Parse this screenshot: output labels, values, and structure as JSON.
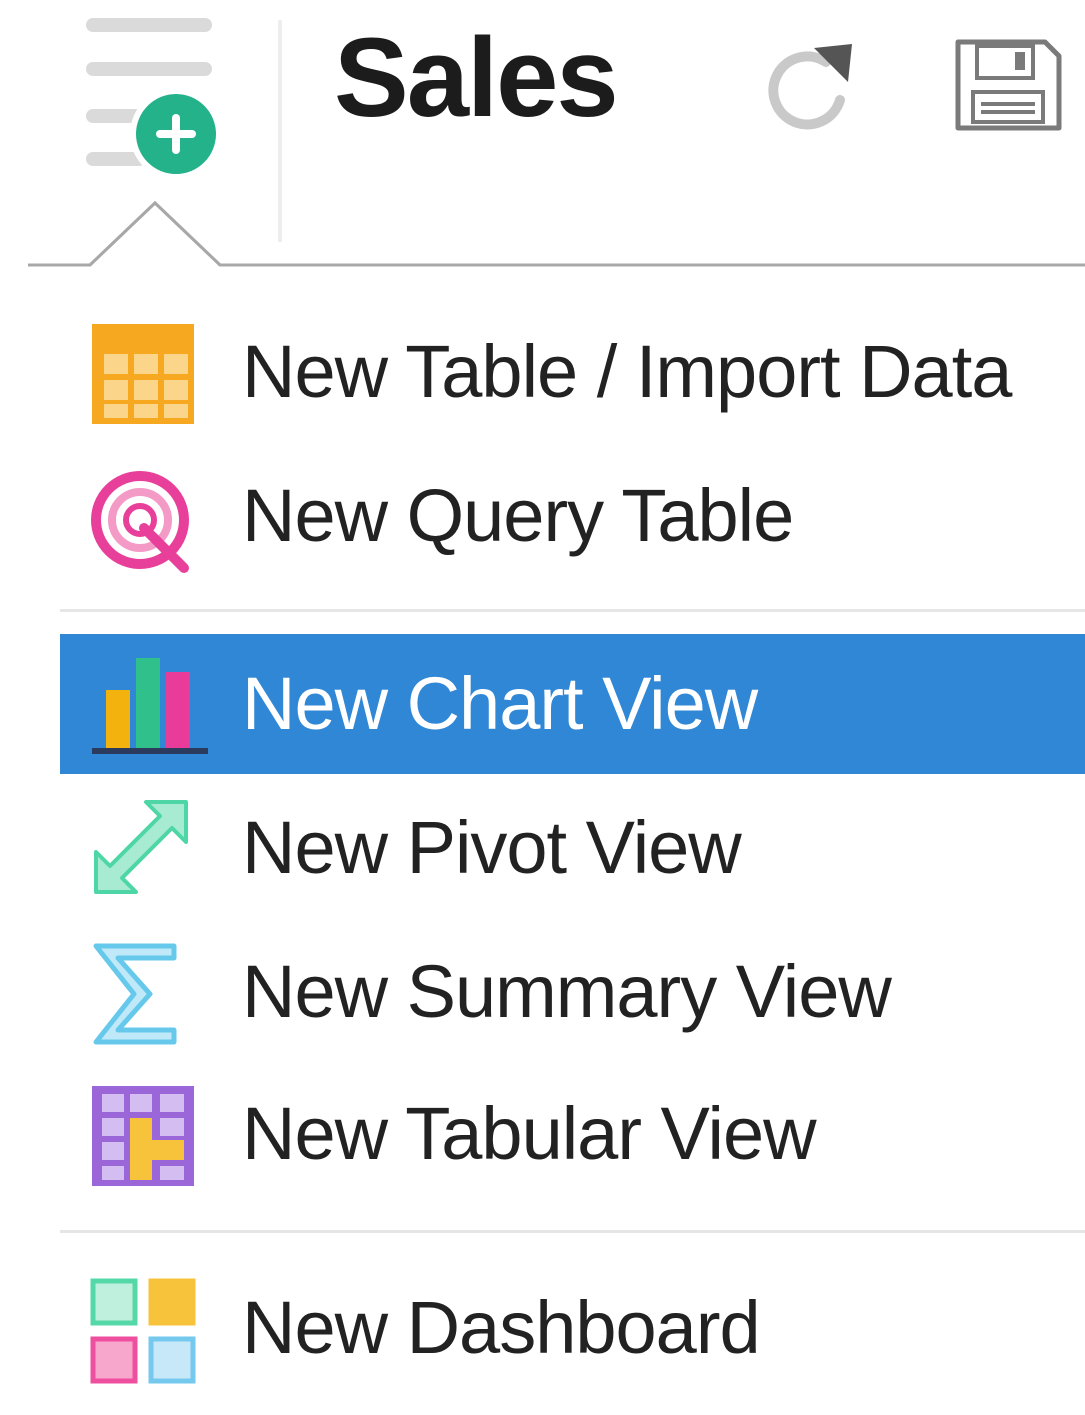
{
  "header": {
    "title": "Sales"
  },
  "menu": {
    "items": [
      {
        "label": "New Table / Import Data",
        "icon": "table-icon"
      },
      {
        "label": "New Query Table",
        "icon": "query-table-icon"
      },
      {
        "label": "New Chart View",
        "icon": "chart-icon",
        "selected": true
      },
      {
        "label": "New Pivot View",
        "icon": "pivot-icon"
      },
      {
        "label": "New Summary View",
        "icon": "sigma-icon"
      },
      {
        "label": "New Tabular View",
        "icon": "tabular-view-icon"
      },
      {
        "label": "New Dashboard",
        "icon": "dashboard-icon"
      }
    ]
  },
  "colors": {
    "selected_background": "#2f87d6",
    "add_badge": "#23b28a",
    "table_icon": "#f6a821",
    "query_icon": "#e8409a",
    "chart_yellow": "#f4b20e",
    "chart_green": "#2fc08c",
    "chart_pink": "#e83b9a",
    "pivot_icon": "#4fd6a7",
    "summary_icon": "#66c9ec",
    "tabular_icon": "#9a66d8",
    "dashboard_green": "#55d8a8",
    "dashboard_yellow": "#f6c33a",
    "dashboard_pink": "#ef4f9f",
    "dashboard_blue": "#76c9ee"
  }
}
